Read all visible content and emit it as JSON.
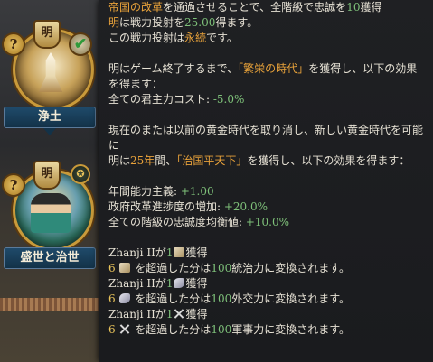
{
  "reforms": [
    {
      "name": "浄土",
      "medallion": "明",
      "status": "check"
    },
    {
      "name": "盛世と治世",
      "medallion": "明",
      "status": "medal"
    }
  ],
  "tooltip": {
    "line1": {
      "pre": "",
      "hl": "帝国の改革",
      "post": "を通過させることで、全階級で忠誠を",
      "num": "10",
      "end": "獲得"
    },
    "line2": {
      "hl": "明",
      "pre": "は戦力投射を",
      "num": "25.00",
      "end": "得ます。"
    },
    "line3": {
      "pre": "この戦力投射は",
      "hl": "永続",
      "end": "です。"
    },
    "line4": {
      "pre": "明はゲーム終了するまで、",
      "hl": "「繁栄の時代」",
      "end": "を獲得し、以下の効果"
    },
    "line5": "を得ます：",
    "line6": {
      "pre": "全ての君主力コスト: ",
      "val": "-5.0%"
    },
    "line7": "現在のまたは以前の黄金時代を取り消し、新しい黄金時代を可能",
    "line8": "に",
    "line9": {
      "pre": "明は",
      "num": "25年",
      "mid": "間、",
      "hl": "「治国平天下」",
      "end": "を獲得し、以下の効果を得ます："
    },
    "line10": {
      "pre": "年間能力主義: ",
      "val": "+1.00"
    },
    "line11": {
      "pre": "政府改革進捗度の増加: ",
      "val": "+20.0%"
    },
    "line12": {
      "pre": "全ての階級の忠誠度均衡値: ",
      "val": "+10.0%"
    },
    "bonuses": [
      {
        "who": "Zhanji II",
        "ga": "が",
        "n": "1",
        "icon": "admin-scroll-icon",
        "get": "獲得",
        "thr": "6",
        "mid": "を超過した分は",
        "pct": "100",
        "end": "統治力に変換されます。"
      },
      {
        "who": "Zhanji II",
        "ga": "が",
        "n": "1",
        "icon": "diplomacy-dove-icon",
        "get": "獲得",
        "thr": "6",
        "mid": "を超過した分は",
        "pct": "100",
        "end": "外交力に変換されます。"
      },
      {
        "who": "Zhanji II",
        "ga": "が",
        "n": "1",
        "icon": "military-swords-icon",
        "get": "獲得",
        "thr": "6",
        "mid": "を超過した分は",
        "pct": "100",
        "end": "軍事力に変換されます。"
      }
    ]
  }
}
